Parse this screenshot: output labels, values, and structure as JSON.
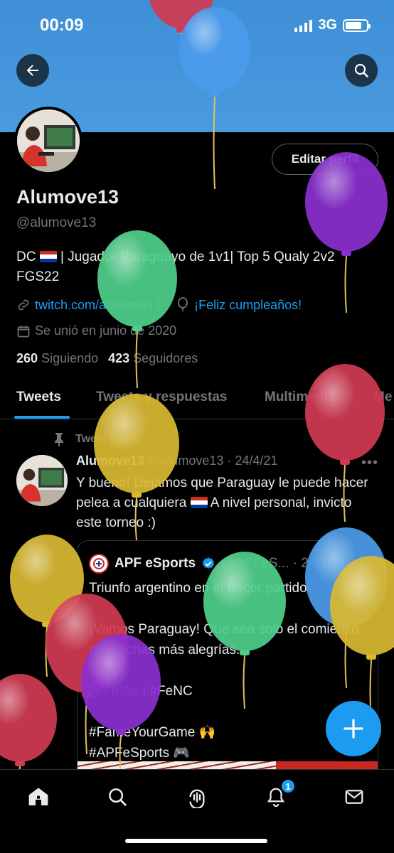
{
  "status_bar": {
    "time": "00:09",
    "network": "3G",
    "battery_level": 0.8
  },
  "header": {
    "back_icon": "arrow-left-icon",
    "search_icon": "search-icon"
  },
  "profile": {
    "edit_label": "Editar perfil",
    "name": "Alumove13",
    "handle": "@alumove13",
    "bio_prefix": "DC",
    "bio_rest": " | Jugador Paraguayo de 1v1| Top 5 Qualy 2v2 FGS22",
    "link": "twitch.com/alumove13",
    "birthday": "¡Feliz cumpleaños!",
    "joined": "Se unió en junio de 2020",
    "following_count": "260",
    "following_label": "Siguiendo",
    "followers_count": "423",
    "followers_label": "Seguidores"
  },
  "tabs": [
    {
      "label": "Tweets"
    },
    {
      "label": "Tweets y respuestas"
    },
    {
      "label": "Multimedia"
    },
    {
      "label": "Me"
    }
  ],
  "tweet": {
    "pinned_label": "Tweet fijado",
    "author": "Alumove13",
    "meta": "@alumove13 · 24/4/21",
    "text_1": "Y bueno! Dejamos que Paraguay le puede hacer pelea a cualquiera",
    "text_2": " A nivel personal, invicto este torneo :)",
    "quote": {
      "author": "APF eSports",
      "meta": "@APFeS... · 24/4/21",
      "line_1": "Triunfo argentino en el tercer partido.",
      "line_2": "¡Vamos Paraguay! Que sea solo el comienzo de muchas más alegrías.",
      "mention": "@FIFAe",
      "hashtag_1": " | #FeNC",
      "line_4": "#FameYourGame 🙌",
      "line_5": "#APFeSports 🎮"
    }
  },
  "nav": {
    "home": "home-icon",
    "search": "search-icon",
    "spaces": "spaces-icon",
    "notifications": "bell-icon",
    "notifications_badge": "1",
    "messages": "mail-icon"
  },
  "colors": {
    "accent": "#1d9bf0",
    "banner": "#4a9ae0",
    "background": "#000000"
  }
}
